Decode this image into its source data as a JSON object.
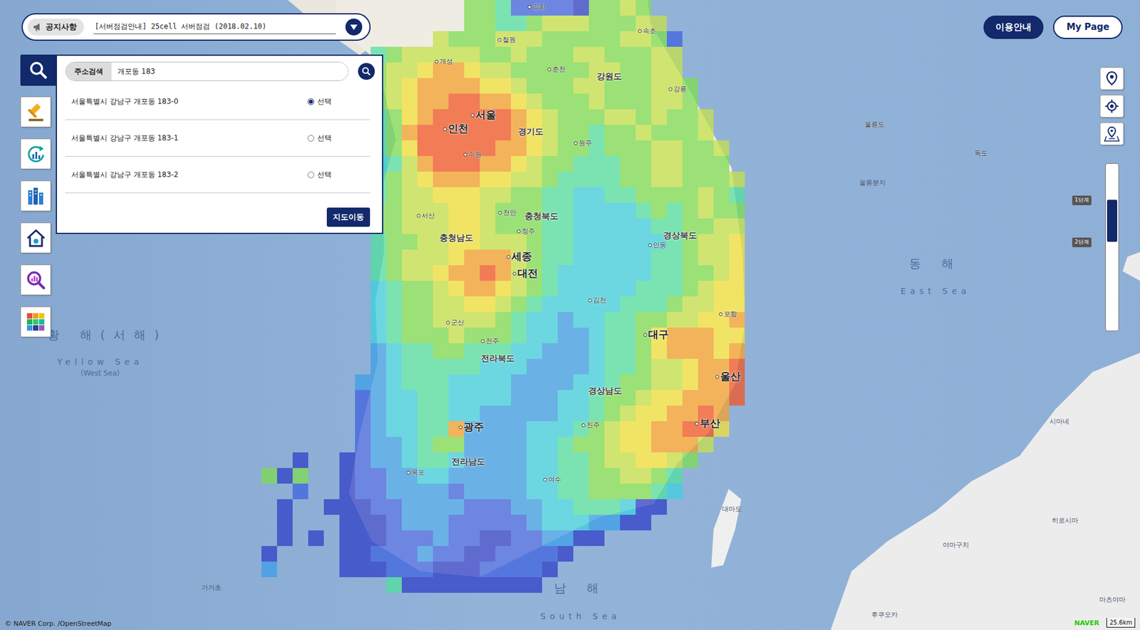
{
  "notice": {
    "label": "공지사항",
    "text": "[서버점검안내] 25cell 서버점검 (2018.02.10)"
  },
  "top_buttons": [
    "이용안내",
    "My Page"
  ],
  "sidebar": {
    "items": [
      {
        "selected": true
      },
      {
        "selected": false
      },
      {
        "selected": false
      },
      {
        "selected": false
      },
      {
        "selected": false
      },
      {
        "selected": false
      },
      {
        "selected": false
      }
    ]
  },
  "search": {
    "tab": "주소검색",
    "value": "개포동 183",
    "results": [
      {
        "address": "서울특별시 강남구 개포동 183-0",
        "option": "선택",
        "selected": true
      },
      {
        "address": "서울특별시 강남구 개포동 183-1",
        "option": "선택",
        "selected": false
      },
      {
        "address": "서울특별시 강남구 개포동 183-2",
        "option": "선택",
        "selected": false
      }
    ],
    "button": "지도이동"
  },
  "zoom": {
    "level": 0.29,
    "marks": [
      "1단계",
      "2단계"
    ]
  },
  "heatmap": {
    "rows": [
      ".............554111105565......",
      ".............5544566655566.....",
      "...........6555666555556651....",
      ".......45666665565556655566....",
      ".......56678876655555665566....",
      ".......567888877655566555665...",
      ".......567889988765556555665...",
      ".......4578999998765556656556..",
      ".......4589999998765545565556..",
      ".......45799999887655455566556.",
      ".......34689998876554445566555.",
      ".......456788877665444455665556",
      ".......456677766554433445555654",
      ".......556667765554433334545655",
      ".......556667765554433333445566",
      ".......455667766654433333345667",
      ".......456667888654433333445667",
      ".......456678898654333333445567",
      ".......345567887654333334445677",
      ".......345566776543333344456677",
      ".......345566665433233445566778",
      ".......345556555433223445788877",
      ".......234455444332223445788878",
      ".......234444433322223445667889",
      "......2234443333222233455667889",
      "......1233443333222334556778889",
      "......123344332222233456778898.",
      "......123344822223334567788997.",
      "......12234552222334556778886..",
      "..0..01223443222233445667765...",
      "505..0112233222223344556654....",
      "..1..0112222122223344555543....",
      ".0..0001122221112233444300.....",
      ".0...00012221111123332200......",
      ".0.0.00011121100112200.........",
      "0....001112110011110...........",
      "2....00011100011110............",
      "........4000000000............."
    ]
  },
  "labels": [
    {
      "text": "서울",
      "kind": "metro"
    },
    {
      "text": "인천",
      "kind": "metro"
    },
    {
      "text": "세종",
      "kind": "metro"
    },
    {
      "text": "대전",
      "kind": "metro"
    },
    {
      "text": "대구",
      "kind": "metro"
    },
    {
      "text": "울산",
      "kind": "metro"
    },
    {
      "text": "부산",
      "kind": "metro"
    },
    {
      "text": "광주",
      "kind": "metro"
    },
    {
      "text": "경기도",
      "kind": "province"
    },
    {
      "text": "강원도",
      "kind": "province"
    },
    {
      "text": "충청북도",
      "kind": "province"
    },
    {
      "text": "충청남도",
      "kind": "province"
    },
    {
      "text": "경상북도",
      "kind": "province"
    },
    {
      "text": "경상남도",
      "kind": "province"
    },
    {
      "text": "전라북도",
      "kind": "province"
    },
    {
      "text": "전라남도",
      "kind": "province"
    },
    {
      "text": "개성",
      "kind": "city"
    },
    {
      "text": "춘천",
      "kind": "city"
    },
    {
      "text": "강릉",
      "kind": "city"
    },
    {
      "text": "포항",
      "kind": "city"
    },
    {
      "text": "목포",
      "kind": "city"
    },
    {
      "text": "여수",
      "kind": "city"
    },
    {
      "text": "진주",
      "kind": "city"
    },
    {
      "text": "청주",
      "kind": "city"
    },
    {
      "text": "전주",
      "kind": "city"
    },
    {
      "text": "원주",
      "kind": "city"
    },
    {
      "text": "안동",
      "kind": "city"
    },
    {
      "text": "김화",
      "kind": "city"
    },
    {
      "text": "철원",
      "kind": "city"
    },
    {
      "text": "속초",
      "kind": "city"
    },
    {
      "text": "수원",
      "kind": "city"
    },
    {
      "text": "천안",
      "kind": "city"
    },
    {
      "text": "서산",
      "kind": "city"
    },
    {
      "text": "군산",
      "kind": "city"
    },
    {
      "text": "김천",
      "kind": "city"
    },
    {
      "text": "동 해",
      "kind": "sea"
    },
    {
      "text": "East Sea",
      "kind": "sea-en"
    },
    {
      "text": "황 해(서해)",
      "kind": "sea"
    },
    {
      "text": "Yellow Sea",
      "kind": "sea-en"
    },
    {
      "text": "(West Sea)",
      "kind": "sea-note"
    },
    {
      "text": "남 해",
      "kind": "sea"
    },
    {
      "text": "South Sea",
      "kind": "sea-en"
    },
    {
      "text": "대마도",
      "kind": "foreign"
    },
    {
      "text": "울릉도",
      "kind": "island"
    },
    {
      "text": "독도",
      "kind": "island"
    },
    {
      "text": "울릉분지",
      "kind": "foreign"
    },
    {
      "text": "시마네",
      "kind": "foreign"
    },
    {
      "text": "히로시마",
      "kind": "foreign"
    },
    {
      "text": "야마구치",
      "kind": "foreign"
    },
    {
      "text": "후쿠오카",
      "kind": "foreign"
    },
    {
      "text": "가거초",
      "kind": "foreign"
    },
    {
      "text": "마츠야마",
      "kind": "foreign"
    }
  ],
  "footer": {
    "copyright": "© NAVER Corp. /OpenStreetMap",
    "brand": "NAVER",
    "scale": "25.6km"
  }
}
